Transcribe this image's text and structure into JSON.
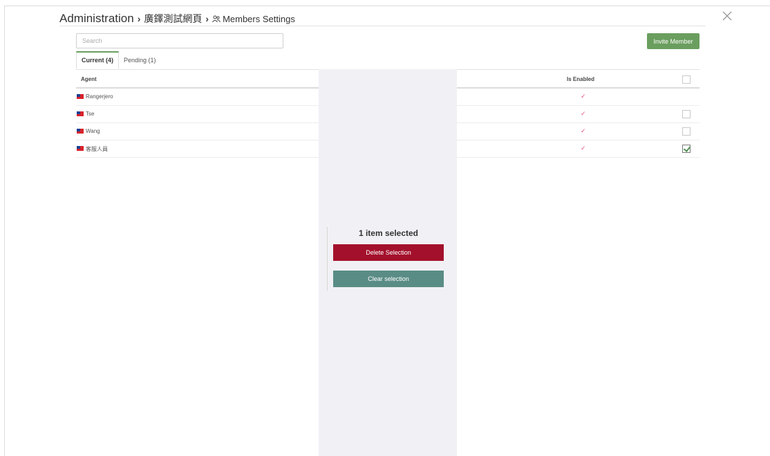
{
  "breadcrumb": {
    "root": "Administration",
    "separator": "›",
    "page": "廣鐸測試網頁",
    "current": "Members Settings",
    "current_icon": "members-icon"
  },
  "close_icon": "close-icon",
  "search": {
    "placeholder": "Search",
    "value": ""
  },
  "invite_button": "Invite Member",
  "tabs": [
    {
      "label": "Current (4)",
      "active": true
    },
    {
      "label": "Pending (1)",
      "active": false
    }
  ],
  "table": {
    "columns": {
      "agent": "Agent",
      "enabled": "Is Enabled"
    },
    "header_checkbox_checked": false,
    "rows": [
      {
        "agent": "Rangerjero",
        "enabled": "✓",
        "has_checkbox": false,
        "checked": false
      },
      {
        "agent": "Tse",
        "enabled": "✓",
        "has_checkbox": true,
        "checked": false
      },
      {
        "agent": "Wang",
        "enabled": "✓",
        "has_checkbox": true,
        "checked": false
      },
      {
        "agent": "客服人員",
        "enabled": "✓",
        "has_checkbox": true,
        "checked": true
      }
    ]
  },
  "selection_panel": {
    "count_text": "1 item selected",
    "delete_label": "Delete Selection",
    "clear_label": "Clear selection"
  },
  "colors": {
    "accent_green": "#6a9e5e",
    "delete_red": "#a3102b",
    "clear_teal": "#5a8c86",
    "check_pink": "#e0507a"
  }
}
